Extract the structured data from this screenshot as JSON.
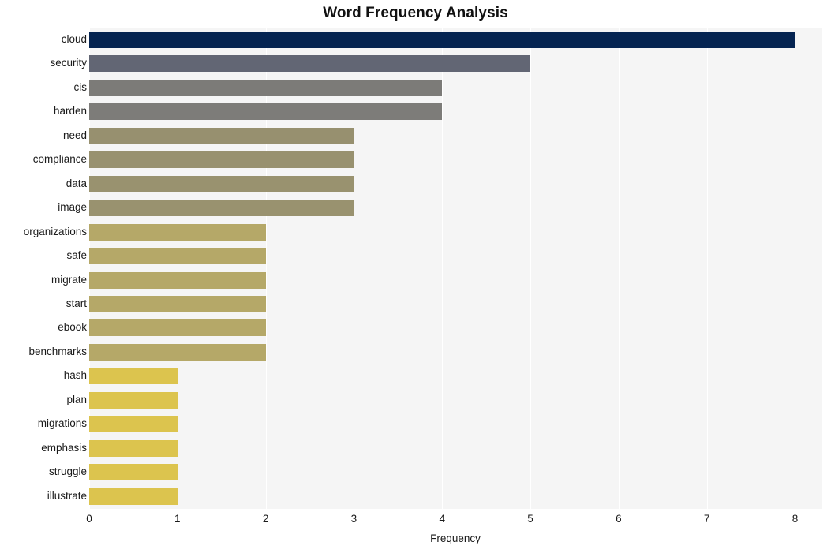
{
  "chart_data": {
    "type": "bar",
    "orientation": "horizontal",
    "title": "Word Frequency Analysis",
    "xlabel": "Frequency",
    "ylabel": "",
    "xlim": [
      0,
      8.3
    ],
    "xticks": [
      "0",
      "1",
      "2",
      "3",
      "4",
      "5",
      "6",
      "7",
      "8"
    ],
    "grid": "vertical",
    "legend": "none",
    "categories": [
      "cloud",
      "security",
      "cis",
      "harden",
      "need",
      "compliance",
      "data",
      "image",
      "organizations",
      "safe",
      "migrate",
      "start",
      "ebook",
      "benchmarks",
      "hash",
      "plan",
      "migrations",
      "emphasis",
      "struggle",
      "illustrate"
    ],
    "values": [
      8,
      5,
      4,
      4,
      3,
      3,
      3,
      3,
      2,
      2,
      2,
      2,
      2,
      2,
      1,
      1,
      1,
      1,
      1,
      1
    ],
    "bar_colors": [
      "#052451",
      "#626674",
      "#7c7b78",
      "#7d7c79",
      "#97906f",
      "#98916f",
      "#99926f",
      "#99926f",
      "#b5a868",
      "#b5a868",
      "#b5a868",
      "#b5a868",
      "#b5a868",
      "#b5a868",
      "#dcc44e",
      "#dcc44e",
      "#dcc44e",
      "#dcc44e",
      "#dcc44e",
      "#dcc44e"
    ]
  },
  "style": {
    "plot_background": "#f5f5f5",
    "page_background": "#ffffff",
    "gridline_color": "#ffffff",
    "text_color": "#1a1a1a",
    "title_color": "#111111"
  }
}
